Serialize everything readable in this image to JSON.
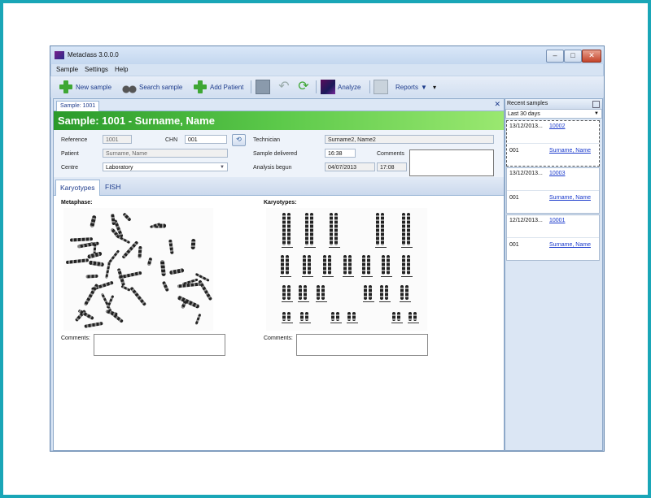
{
  "window": {
    "title": "Metaclass 3.0.0.0"
  },
  "menu": [
    "Sample",
    "Settings",
    "Help"
  ],
  "toolbar": {
    "new_sample": "New sample",
    "search_sample": "Search sample",
    "add_patient": "Add Patient",
    "analyze": "Analyze",
    "reports": "Reports"
  },
  "doc_tab": "Sample: 1001",
  "header": "Sample: 1001 - Surname, Name",
  "form": {
    "reference_label": "Reference",
    "reference_value": "1001",
    "chn_label": "CHN",
    "chn_value": "001",
    "patient_label": "Patient",
    "patient_value": "Surname, Name",
    "centre_label": "Centre",
    "centre_value": "Laboratory",
    "technician_label": "Technician",
    "technician_value": "Surname2, Name2",
    "delivered_label": "Sample delivered",
    "delivered_time": "16:38",
    "analysis_label": "Analysis begun",
    "analysis_date": "04/07/2013",
    "analysis_time": "17:08",
    "comments_label": "Comments"
  },
  "tabs": [
    "Karyotypes",
    "FISH"
  ],
  "sections": {
    "metaphase": "Metaphase:",
    "karyotypes": "Karyotypes:",
    "comments": "Comments:"
  },
  "recent": {
    "title": "Recent samples",
    "filter": "Last 30 days",
    "items": [
      {
        "date": "13/12/2013...",
        "id": "10002",
        "chn": "001",
        "patient": "Surname, Name"
      },
      {
        "date": "13/12/2013...",
        "id": "10003",
        "chn": "001",
        "patient": "Surname, Name"
      },
      {
        "date": "12/12/2013...",
        "id": "10001",
        "chn": "001",
        "patient": "Surname, Name"
      }
    ]
  },
  "colors": {
    "header_green": "#2a9a2a",
    "frame": "#1aa6b7",
    "link": "#1a3acc"
  }
}
